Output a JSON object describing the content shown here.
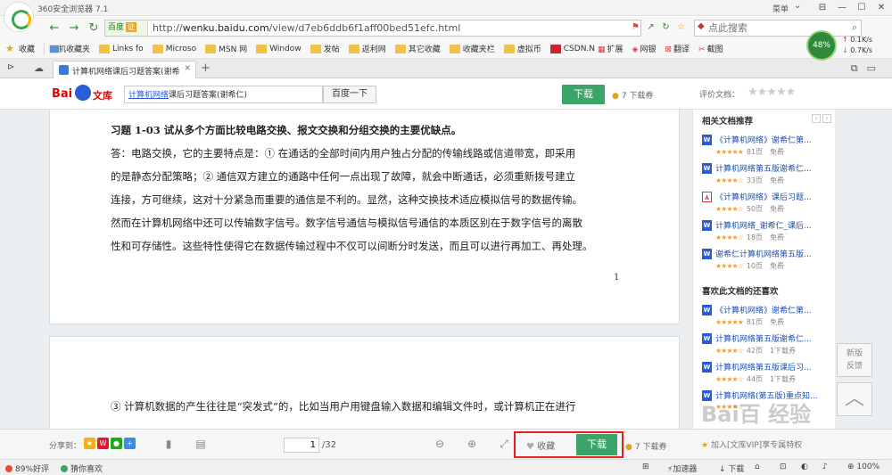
{
  "browser": {
    "app_title": "360安全浏览器 7.1",
    "menu_label": "菜单",
    "window_buttons": [
      "⊟",
      "—",
      "☐",
      "✕"
    ],
    "url_mode": "百度",
    "url_cert": "证",
    "url_host": "wenku.baidu.com",
    "url_prefix": "http://",
    "url_path": "/view/d7eb6ddb6f1aff00bed51efc.html",
    "search_placeholder": "点此搜索",
    "speed": {
      "percent": "48%",
      "up": "0.1K/s",
      "down": "0.7K/s"
    }
  },
  "bookmarks": [
    {
      "label": "收藏",
      "icon": "star-icon"
    },
    {
      "label": "手机收藏夹",
      "icon": "folder-icon"
    },
    {
      "label": "Links fo",
      "icon": "folder-icon"
    },
    {
      "label": "Microso",
      "icon": "folder-icon"
    },
    {
      "label": "MSN 网",
      "icon": "folder-icon"
    },
    {
      "label": "Window",
      "icon": "folder-icon"
    },
    {
      "label": "发帖",
      "icon": "folder-icon"
    },
    {
      "label": "返利网",
      "icon": "folder-icon"
    },
    {
      "label": "其它收藏",
      "icon": "folder-icon"
    },
    {
      "label": "收藏夹栏",
      "icon": "folder-icon"
    },
    {
      "label": "虚拟币",
      "icon": "folder-icon"
    },
    {
      "label": "CSDN.N",
      "icon": "csdn-icon"
    }
  ],
  "toolbar_tools": [
    "扩展",
    "网银",
    "翻译",
    "截图"
  ],
  "tab": {
    "title": "计算机网络课后习题答案(谢希",
    "close": "✕",
    "new": "+"
  },
  "wenku": {
    "logo_text": "文库",
    "search_query_linked": "计算机网络",
    "search_query_rest": "课后习题答案(谢希仁)",
    "search_button": "百度一下",
    "download_label": "下载",
    "coupon_label": "7 下载券",
    "rate_label": "评价文档：",
    "rating_stars": "★★★★★"
  },
  "doc": {
    "heading": "习题 1-03  试从多个方面比较电路交换、报文交换和分组交换的主要优缺点。",
    "lines": [
      "答：电路交换，它的主要特点是：① 在通话的全部时间内用户独占分配的传输线路或信道带宽，即采用",
      "的是静态分配策略；② 通信双方建立的通路中任何一点出现了故障，就会中断通话，必须重新拨号建立",
      "连接，方可继续，这对十分紧急而重要的通信是不利的。显然，这种交换技术适应模拟信号的数据传输。",
      "然而在计算机网络中还可以传输数字信号。数字信号通信与模拟信号通信的本质区别在于数字信号的离散",
      "性和可存储性。这些特性使得它在数据传输过程中不仅可以间断分时发送，而且可以进行再加工、再处理。"
    ],
    "page_number": "1",
    "page2_line": "③ 计算机数据的产生往往是“突发式”的，比如当用户用键盘输入数据和编辑文件时，或计算机正在进行"
  },
  "sidebar": {
    "related_title": "相关文档推荐",
    "related": [
      {
        "title": "《计算机网络》谢希仁第...",
        "stars": "★★★★★",
        "pages": "81页",
        "price": "免费",
        "type": "W"
      },
      {
        "title": "计算机网络第五版谢希仁...",
        "stars": "★★★★☆",
        "pages": "33页",
        "price": "免费",
        "type": "W"
      },
      {
        "title": "《计算机网络》课后习题...",
        "stars": "★★★★☆",
        "pages": "50页",
        "price": "免费",
        "type": "PDF"
      },
      {
        "title": "计算机网络_谢希仁_课后...",
        "stars": "★★★★☆",
        "pages": "18页",
        "price": "免费",
        "type": "W"
      },
      {
        "title": "谢希仁计算机网络第五版...",
        "stars": "★★★★☆",
        "pages": "10页",
        "price": "免费",
        "type": "W"
      }
    ],
    "liked_title": "喜欢此文档的还喜欢",
    "liked": [
      {
        "title": "《计算机网络》谢希仁第...",
        "stars": "★★★★★",
        "pages": "81页",
        "price": "免费",
        "type": "W"
      },
      {
        "title": "计算机网络第五版谢希仁...",
        "stars": "★★★★☆",
        "pages": "42页",
        "price": "1下载券",
        "type": "W"
      },
      {
        "title": "计算机网络第五版课后习...",
        "stars": "★★★★☆",
        "pages": "44页",
        "price": "1下载券",
        "type": "W"
      },
      {
        "title": "计算机网络(第五版)重点知...",
        "stars": "★★★★☆",
        "pages": "",
        "price": "",
        "type": "W"
      }
    ],
    "feedback": "新版\n反馈",
    "to_top": "︿"
  },
  "watermark": "Bai百 经验",
  "readbar": {
    "share_label": "分享到：",
    "page_current": "1",
    "page_total": "/32",
    "fav_label": "收藏",
    "download_label": "下载",
    "coupon_label": "7 下载券",
    "promo": "加入[文库VIP]享专属特权"
  },
  "status": {
    "rating": "89%好评",
    "guess": "猜你喜欢",
    "accelerate": "加速器",
    "download": "下载",
    "zoom": "100%"
  },
  "colors": {
    "accent_green": "#3aa46a",
    "link_blue": "#1a4fb5",
    "highlight_red": "#e62020",
    "baidu_red": "#e10602"
  }
}
